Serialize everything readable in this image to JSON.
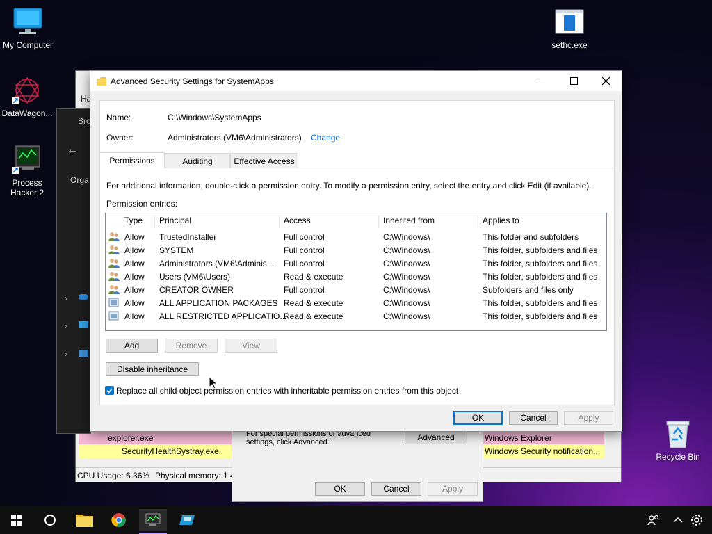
{
  "desktop": {
    "icons": [
      {
        "label": "My Computer"
      },
      {
        "label": "DataWagon..."
      },
      {
        "label": "Process Hacker 2"
      },
      {
        "label": "sethc.exe"
      },
      {
        "label": "Recycle Bin"
      }
    ]
  },
  "background": {
    "explorer_title": "Bro",
    "explorer_org": "Orga",
    "ph_tab": "Ha",
    "ph_rows": [
      {
        "name": "explorer.exe",
        "desc": "Windows Explorer"
      },
      {
        "name": "SecurityHealthSystray.exe",
        "desc": "Windows Security notification..."
      }
    ],
    "ph_status_cpu": "CPU Usage: 6.36%",
    "ph_status_mem": "Physical memory: 1.4",
    "props_text": "For special permissions or advanced settings, click Advanced.",
    "props_advanced": "Advanced",
    "props_ok": "OK",
    "props_cancel": "Cancel",
    "props_apply": "Apply"
  },
  "dialog": {
    "title": "Advanced Security Settings for SystemApps",
    "name_label": "Name:",
    "name_value": "C:\\Windows\\SystemApps",
    "owner_label": "Owner:",
    "owner_value": "Administrators (VM6\\Administrators)",
    "change_link": "Change",
    "tabs": [
      {
        "label": "Permissions"
      },
      {
        "label": "Auditing"
      },
      {
        "label": "Effective Access"
      }
    ],
    "info_text": "For additional information, double-click a permission entry. To modify a permission entry, select the entry and click Edit (if available).",
    "entries_label": "Permission entries:",
    "columns": {
      "type": "Type",
      "principal": "Principal",
      "access": "Access",
      "inherited": "Inherited from",
      "applies": "Applies to"
    },
    "entries": [
      {
        "type": "Allow",
        "principal": "TrustedInstaller",
        "access": "Full control",
        "inherited": "C:\\Windows\\",
        "applies": "This folder and subfolders",
        "icon": "user-group-icon"
      },
      {
        "type": "Allow",
        "principal": "SYSTEM",
        "access": "Full control",
        "inherited": "C:\\Windows\\",
        "applies": "This folder, subfolders and files",
        "icon": "user-group-icon"
      },
      {
        "type": "Allow",
        "principal": "Administrators (VM6\\Adminis...",
        "access": "Full control",
        "inherited": "C:\\Windows\\",
        "applies": "This folder, subfolders and files",
        "icon": "user-group-icon"
      },
      {
        "type": "Allow",
        "principal": "Users (VM6\\Users)",
        "access": "Read & execute",
        "inherited": "C:\\Windows\\",
        "applies": "This folder, subfolders and files",
        "icon": "user-group-icon"
      },
      {
        "type": "Allow",
        "principal": "CREATOR OWNER",
        "access": "Full control",
        "inherited": "C:\\Windows\\",
        "applies": "Subfolders and files only",
        "icon": "user-group-icon"
      },
      {
        "type": "Allow",
        "principal": "ALL APPLICATION PACKAGES",
        "access": "Read & execute",
        "inherited": "C:\\Windows\\",
        "applies": "This folder, subfolders and files",
        "icon": "app-package-icon"
      },
      {
        "type": "Allow",
        "principal": "ALL RESTRICTED APPLICATIO...",
        "access": "Read & execute",
        "inherited": "C:\\Windows\\",
        "applies": "This folder, subfolders and files",
        "icon": "app-package-icon"
      }
    ],
    "add_button": "Add",
    "remove_button": "Remove",
    "view_button": "View",
    "disable_inheritance_button": "Disable inheritance",
    "replace_checkbox_label": "Replace all child object permission entries with inheritable permission entries from this object",
    "replace_checked": true,
    "ok_button": "OK",
    "cancel_button": "Cancel",
    "apply_button": "Apply"
  },
  "colors": {
    "link": "#0066cc",
    "accent": "#0078d7",
    "ph_highlight_pink": "#f4b8d4",
    "ph_highlight_yellow": "#ffff99"
  }
}
